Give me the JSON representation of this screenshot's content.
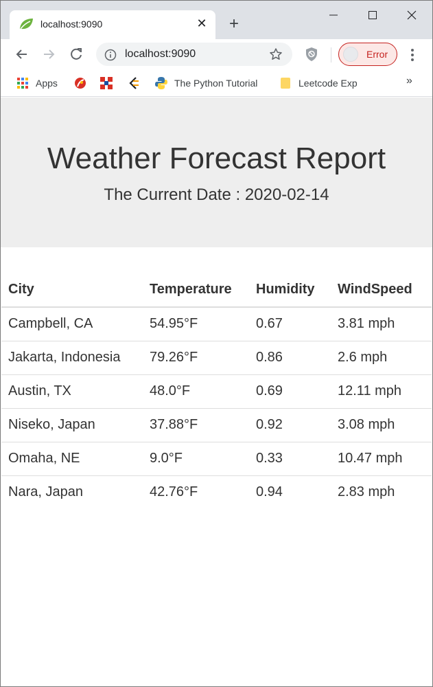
{
  "browser": {
    "tab": {
      "title": "localhost:9090",
      "favicon": "spring-leaf-icon"
    },
    "address_bar": {
      "url": "localhost:9090"
    },
    "profile": {
      "label": "Error"
    },
    "bookmarks": [
      {
        "label": "Apps",
        "icon": "apps-grid-icon"
      },
      {
        "label": "",
        "icon": "red-swirl-icon"
      },
      {
        "label": "",
        "icon": "red-blue-square-icon"
      },
      {
        "label": "",
        "icon": "code-brackets-icon"
      },
      {
        "label": "The Python Tutorial",
        "icon": "python-icon"
      },
      {
        "label": "Leetcode Exp",
        "icon": "folder-icon"
      }
    ],
    "more_bookmarks": "»"
  },
  "page": {
    "title": "Weather Forecast Report",
    "subtitle": "The Current Date : 2020-02-14"
  },
  "table": {
    "headers": [
      "City",
      "Temperature",
      "Humidity",
      "WindSpeed"
    ],
    "rows": [
      [
        "Campbell, CA",
        "54.95°F",
        "0.67",
        "3.81 mph"
      ],
      [
        "Jakarta, Indonesia",
        "79.26°F",
        "0.86",
        "2.6 mph"
      ],
      [
        "Austin, TX",
        "48.0°F",
        "0.69",
        "12.11 mph"
      ],
      [
        "Niseko, Japan",
        "37.88°F",
        "0.92",
        "3.08 mph"
      ],
      [
        "Omaha, NE",
        "9.0°F",
        "0.33",
        "10.47 mph"
      ],
      [
        "Nara, Japan",
        "42.76°F",
        "0.94",
        "2.83 mph"
      ]
    ]
  },
  "colors": {
    "jumbotron_bg": "#eeeeee",
    "text": "#333333",
    "profile_error": "#c5221f",
    "tabstrip": "#dee1e6"
  }
}
